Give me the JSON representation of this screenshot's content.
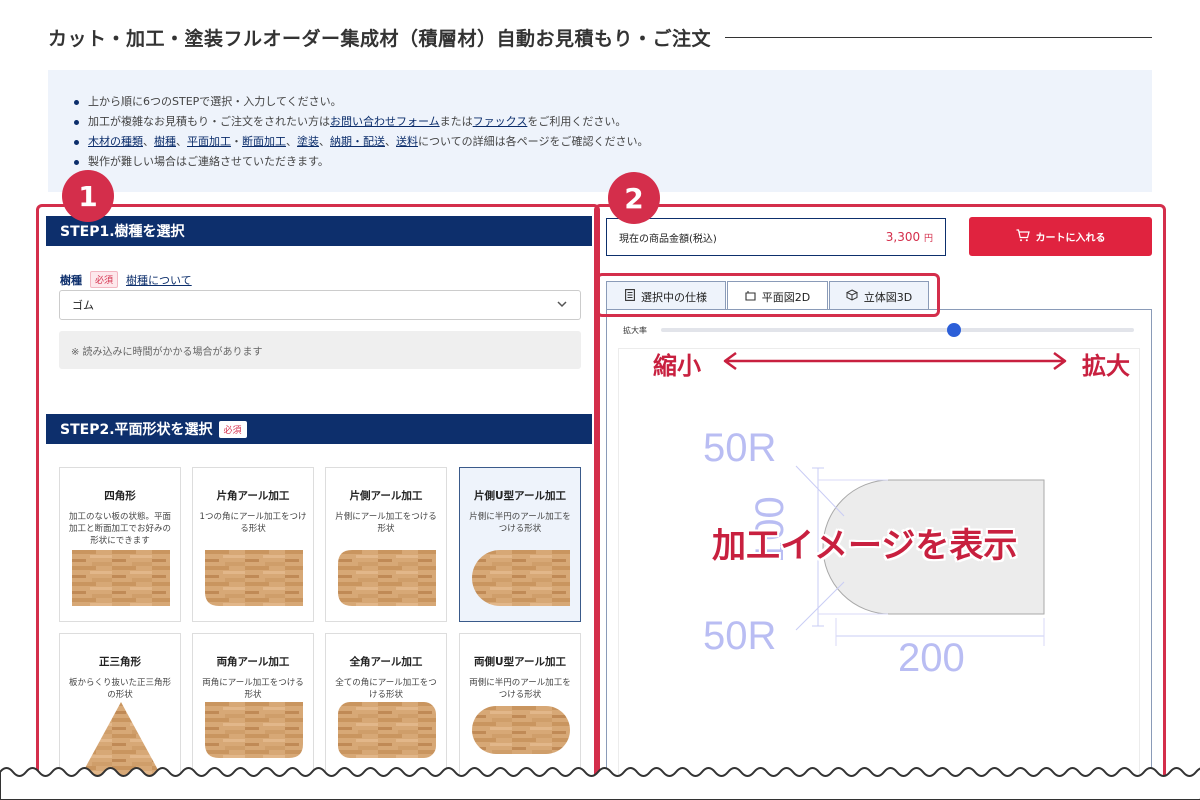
{
  "page_title": "カット・加工・塗装フルオーダー集成材（積層材）自動お見積もり・ご注文",
  "notice": {
    "line1": "上から順に6つのSTEPで選択・入力してください。",
    "line2_a": "加工が複雑なお見積もり・ご注文をされたい方は",
    "line2_link1": "お問い合わせフォーム",
    "line2_b": "または",
    "line2_link2": "ファックス",
    "line2_c": "をご利用ください。",
    "line3_links": [
      "木材の種類",
      "樹種",
      "平面加工",
      "断面加工",
      "塗装",
      "納期・配送",
      "送料"
    ],
    "line3_seps": [
      "、",
      "、",
      "・",
      "、",
      "、",
      "、"
    ],
    "line3_tail": "についての詳細は各ページをご確認ください。",
    "line4": "製作が難しい場合はご連絡させていただきます。"
  },
  "badges": {
    "one": "1",
    "two": "2"
  },
  "step1": {
    "title": "STEP1.樹種を選択",
    "label": "樹種",
    "required": "必須",
    "link": "樹種について",
    "selected": "ゴム",
    "note": "※ 読み込みに時間がかかる場合があります"
  },
  "step2": {
    "title": "STEP2.平面形状を選択",
    "required": "必須",
    "shapes": [
      {
        "name": "四角形",
        "desc": "加工のない板の状態。平面加工と断面加工でお好みの形状にできます"
      },
      {
        "name": "片角アール加工",
        "desc": "1つの角にアール加工をつける形状"
      },
      {
        "name": "片側アール加工",
        "desc": "片側にアール加工をつける形状"
      },
      {
        "name": "片側U型アール加工",
        "desc": "片側に半円のアール加工をつける形状"
      },
      {
        "name": "正三角形",
        "desc": "板からくり抜いた正三角形の形状"
      },
      {
        "name": "両角アール加工",
        "desc": "両角にアール加工をつける形状"
      },
      {
        "name": "全角アール加工",
        "desc": "全ての角にアール加工をつける形状"
      },
      {
        "name": "両側U型アール加工",
        "desc": "両側に半円のアール加工をつける形状"
      }
    ]
  },
  "price": {
    "label": "現在の商品金額(税込)",
    "amount": "3,300",
    "unit": "円"
  },
  "cart_button": "カートに入れる",
  "tabs": [
    "選択中の仕様",
    "平面図2D",
    "立体図3D"
  ],
  "viewer": {
    "zoom_label": "拡大率",
    "zoom_value": 0.62,
    "shrink": "縮小",
    "enlarge": "拡大",
    "caption": "加工イメージを表示",
    "dims": {
      "radius_top": "50R",
      "radius_bottom": "50R",
      "height": "100",
      "width": "200"
    }
  },
  "colors": {
    "navy": "#0d2f6c",
    "accent": "#d42e4b",
    "cart": "#e0233f",
    "notice_bg": "#eef3fb",
    "dim": "#b9bdf3"
  }
}
